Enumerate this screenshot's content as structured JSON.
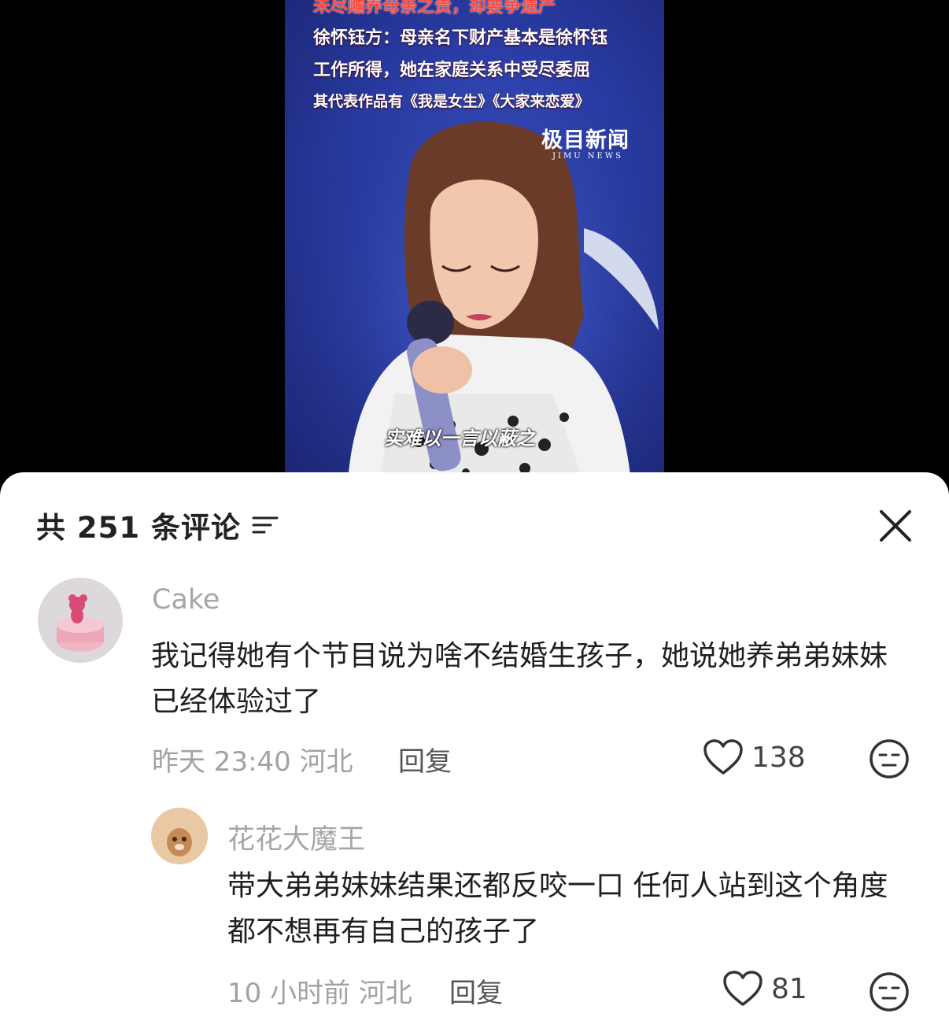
{
  "video": {
    "headline_lines": [
      "未尽赡养母亲之责，却要争遗产",
      "徐怀钰方：母亲名下财产基本是徐怀钰",
      "工作所得，她在家庭关系中受尽委屈",
      "其代表作品有《我是女生》《大家来恋爱》"
    ],
    "watermark_main": "极目新闻",
    "watermark_sub": "JIMU NEWS",
    "subtitle": "实难以一言以蔽之"
  },
  "comments_panel": {
    "count_label": "共 251 条评论",
    "filter_icon": "filter-lines-icon",
    "close_icon": "close-x-icon"
  },
  "comments": [
    {
      "username": "Cake",
      "text": "我记得她有个节目说为啥不结婚生孩子，她说她养弟弟妹妹已经体验过了",
      "time_location": "昨天 23:40 河北",
      "reply_label": "回复",
      "likes": "138"
    },
    {
      "username": "花花大魔王",
      "text": "带大弟弟妹妹结果还都反咬一口 任何人站到这个角度都不想再有自己的孩子了",
      "time_location": "10 小时前 河北",
      "reply_label": "回复",
      "likes": "81"
    }
  ],
  "colors": {
    "sheet_bg": "#ffffff",
    "username_gray": "#a6a6a6",
    "headline_red": "#ff4a3d",
    "video_blue": "#2a3da6"
  }
}
